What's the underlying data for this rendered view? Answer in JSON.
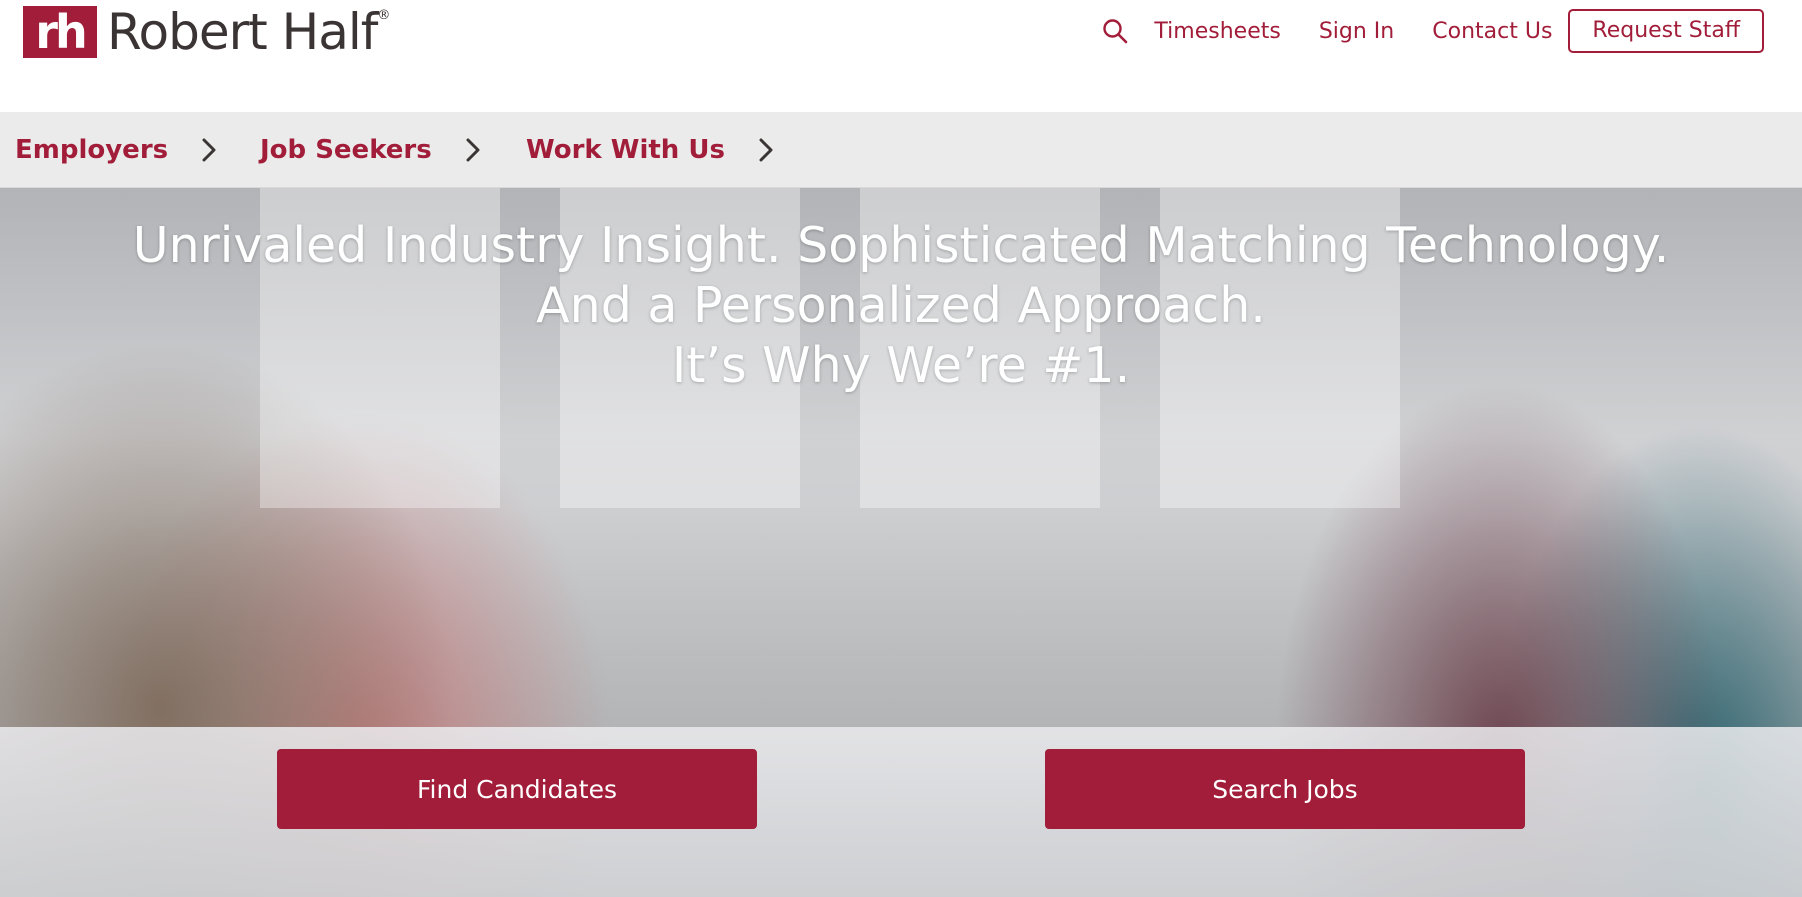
{
  "brand": {
    "logo_mark": "rh",
    "name": "Robert Half",
    "registered": "®",
    "accent_color": "#a21d39"
  },
  "utility_nav": {
    "search_icon": "search-icon",
    "timesheets": "Timesheets",
    "sign_in": "Sign In",
    "contact_us": "Contact Us",
    "request_staff": "Request Staff"
  },
  "main_nav": {
    "items": [
      {
        "label": "Employers",
        "icon": "chevron-right-icon"
      },
      {
        "label": "Job Seekers",
        "icon": "chevron-right-icon"
      },
      {
        "label": "Work With Us",
        "icon": "chevron-right-icon"
      }
    ]
  },
  "hero": {
    "headline_line1": "Unrivaled Industry Insight. Sophisticated Matching Technology.",
    "headline_line2": "And a Personalized Approach.",
    "headline_line3": "It’s Why We’re #1.",
    "find_candidates": "Find Candidates",
    "search_jobs": "Search Jobs"
  }
}
